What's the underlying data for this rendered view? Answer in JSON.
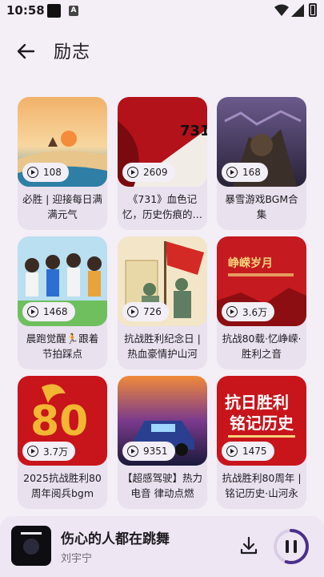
{
  "status": {
    "time": "10:58",
    "notif_glyph": "A"
  },
  "header": {
    "title": "励志"
  },
  "cards": [
    {
      "plays": "108",
      "name": "必胜 | 迎接每日满满元气"
    },
    {
      "plays": "2609",
      "name": "《731》血色记忆，历史伤痕的…"
    },
    {
      "plays": "168",
      "name": "暴雪游戏BGM合集"
    },
    {
      "plays": "1468",
      "name": "晨跑觉醒🏃跟着节拍踩点"
    },
    {
      "plays": "726",
      "name": "抗战胜利纪念日 | 热血豪情护山河"
    },
    {
      "plays": "3.6万",
      "name": "抗战80载·忆峥嵘·胜利之音"
    },
    {
      "plays": "3.7万",
      "name": "2025抗战胜利80周年阅兵bgm"
    },
    {
      "plays": "9351",
      "name": "【超感驾驶】热力电音 律动点燃"
    },
    {
      "plays": "1475",
      "name": "抗战胜利80周年 | 铭记历史·山河永固"
    }
  ],
  "player": {
    "song": "伤心的人都在跳舞",
    "artist": "刘宇宁",
    "progress": 0.55
  },
  "colors": {
    "accent": "#4b2f8a",
    "background": "#f4eef7",
    "card": "#e9e1ee"
  }
}
